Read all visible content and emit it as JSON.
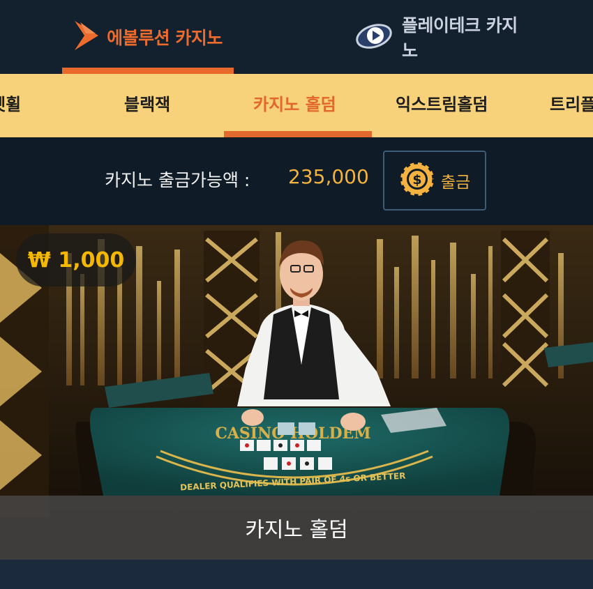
{
  "providers": {
    "evolution": {
      "label": "에볼루션 카지노",
      "icon": "evolution-logo-icon",
      "active": true
    },
    "playtech": {
      "label": "플레이테크 카지노",
      "icon": "playtech-logo-icon"
    }
  },
  "categories": [
    {
      "label": "룰렛휠"
    },
    {
      "label": "블랙잭"
    },
    {
      "label": "카지노 홀덤",
      "active": true
    },
    {
      "label": "익스트림홀덤"
    },
    {
      "label": "트리플"
    }
  ],
  "withdraw": {
    "label": "카지노 출금가능액 :",
    "amount": "235,000",
    "button_label": "출금",
    "button_icon": "dollar-coin-icon"
  },
  "game_card": {
    "bet_min": "₩ 1,000",
    "title": "카지노 홀덤",
    "table_logo": "CASINO HOLDEM",
    "table_text": "DEALER QUALIFIES WITH PAIR OF 4s OR BETTER"
  },
  "colors": {
    "accent_orange": "#e8692a",
    "category_bg": "#f7d27a",
    "gold": "#f4b23e",
    "dark_bg": "#0f1b27"
  }
}
